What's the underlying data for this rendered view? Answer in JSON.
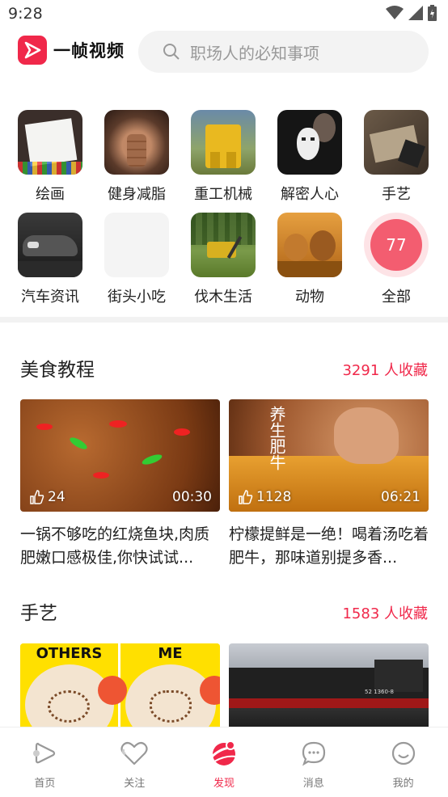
{
  "status": {
    "time": "9:28"
  },
  "app": {
    "name": "一帧视频",
    "brand_color": "#f0284a"
  },
  "search": {
    "placeholder": "职场人的必知事项",
    "icon": "search-icon"
  },
  "categories": [
    {
      "label": "绘画"
    },
    {
      "label": "健身减脂"
    },
    {
      "label": "重工机械"
    },
    {
      "label": "解密人心"
    },
    {
      "label": "手艺"
    },
    {
      "label": "汽车资讯"
    },
    {
      "label": "街头小吃"
    },
    {
      "label": "伐木生活"
    },
    {
      "label": "动物"
    },
    {
      "label": "全部",
      "count": "77"
    }
  ],
  "sections": [
    {
      "title": "美食教程",
      "fav": "3291 人收藏",
      "cards": [
        {
          "likes": "24",
          "duration": "00:30",
          "desc": "一锅不够吃的红烧鱼块,肉质肥嫩口感极佳,你快试试..."
        },
        {
          "likes": "1128",
          "duration": "06:21",
          "overlay": "养生肥牛",
          "desc": "柠檬提鲜是一绝！喝着汤吃着肥牛，那味道别提多香..."
        }
      ]
    },
    {
      "title": "手艺",
      "fav": "1583 人收藏",
      "cards": [
        {
          "img_text_left": "OTHERS",
          "img_text_right": "ME"
        },
        {
          "plate": "52 1360-8"
        }
      ]
    }
  ],
  "tabs": [
    {
      "label": "首页",
      "icon": "home-play-icon"
    },
    {
      "label": "关注",
      "icon": "heart-icon"
    },
    {
      "label": "发现",
      "icon": "discover-icon",
      "active": true
    },
    {
      "label": "消息",
      "icon": "message-icon"
    },
    {
      "label": "我的",
      "icon": "profile-icon"
    }
  ]
}
